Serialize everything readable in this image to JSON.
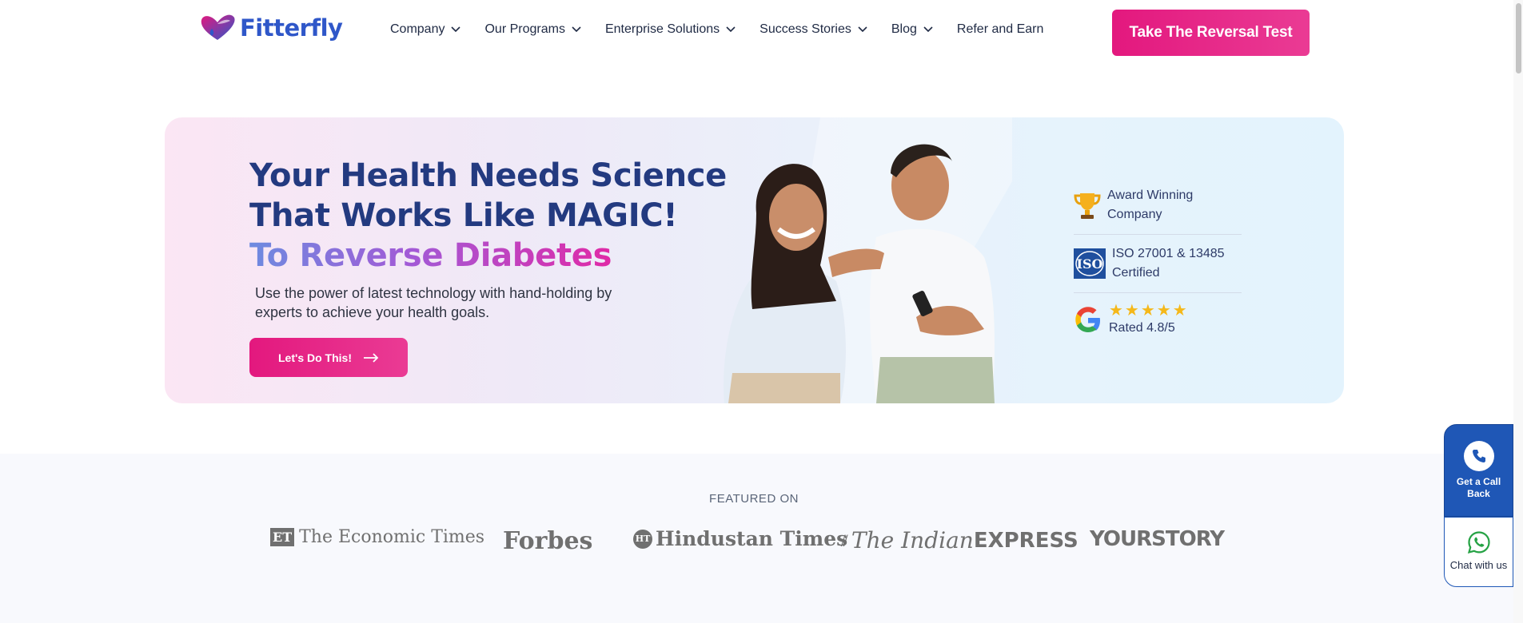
{
  "brand": {
    "name": "Fitterfly"
  },
  "nav": {
    "items": [
      {
        "label": "Company",
        "has_dropdown": true
      },
      {
        "label": "Our Programs",
        "has_dropdown": true
      },
      {
        "label": "Enterprise Solutions",
        "has_dropdown": true
      },
      {
        "label": "Success Stories",
        "has_dropdown": true
      },
      {
        "label": "Blog",
        "has_dropdown": true
      },
      {
        "label": "Refer and Earn",
        "has_dropdown": false
      }
    ],
    "cta_label": "Take The Reversal Test"
  },
  "hero": {
    "line1": "Your Health Needs Science",
    "line2": "That Works Like MAGIC!",
    "line3": "To Reverse Diabetes",
    "subtitle": "Use the power of latest technology with hand-holding by experts to achieve your health goals.",
    "button_label": "Let's Do This!",
    "badges": {
      "award": "Award Winning Company",
      "iso_label": "ISO",
      "iso": "ISO 27001 & 13485 Certified",
      "stars": "★★★★★",
      "rating": "Rated 4.8/5"
    }
  },
  "featured": {
    "label": "FEATURED ON",
    "outlets": {
      "et_box": "ET",
      "et": "The Economic Times",
      "forbes": "Forbes",
      "ht_circle": "HT",
      "ht": "Hindustan Times",
      "ie_italic": "The Indian",
      "ie_bold": "EXPRESS",
      "yourstory": "YOURSTORY"
    }
  },
  "floating": {
    "call_label": "Get a Call Back",
    "chat_label": "Chat with us"
  },
  "colors": {
    "brand_pink": "#e3187e",
    "brand_blue": "#1f57b6",
    "heading_navy": "#233a80"
  }
}
